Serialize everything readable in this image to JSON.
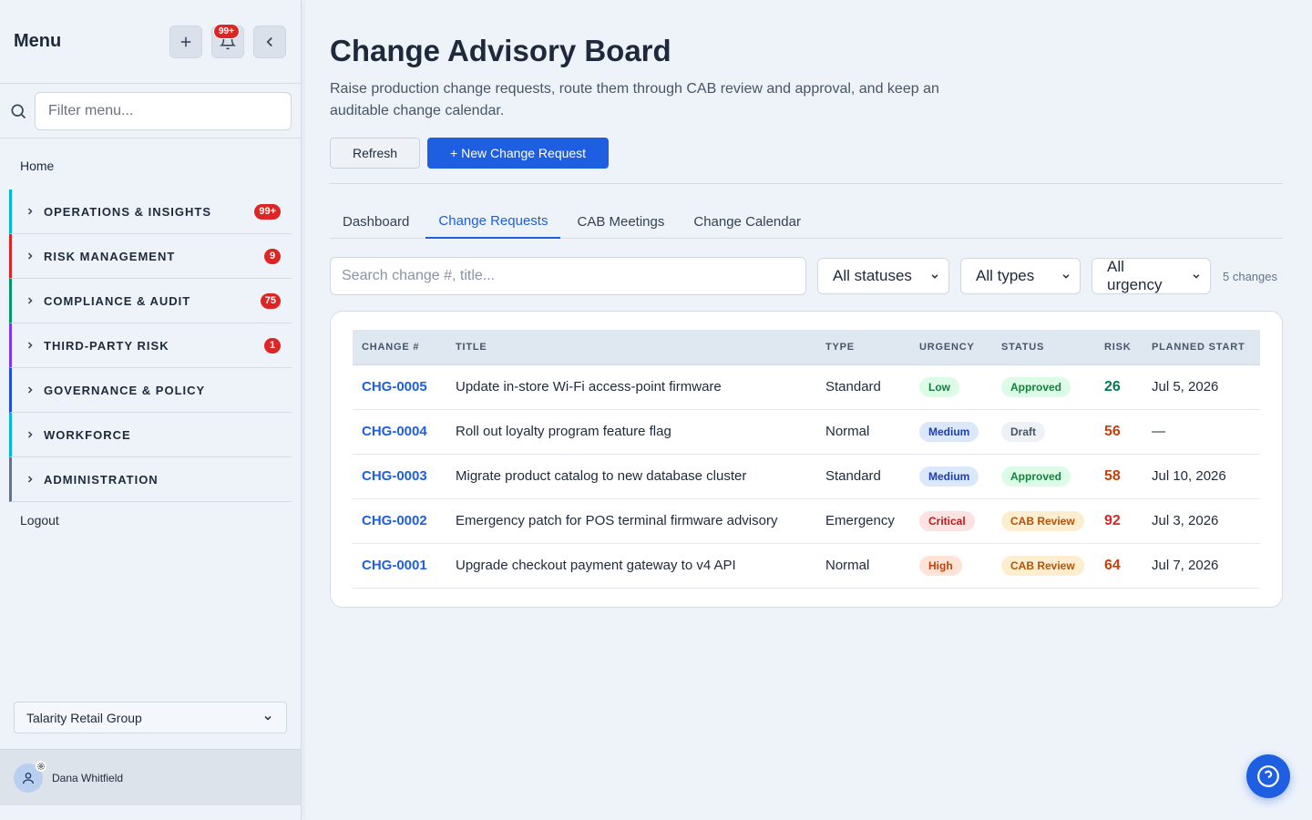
{
  "sidebar": {
    "title": "Menu",
    "notification_count": "99+",
    "filter_placeholder": "Filter menu...",
    "home_label": "Home",
    "logout_label": "Logout",
    "sections": [
      {
        "label": "OPERATIONS & INSIGHTS",
        "badge": "99+",
        "color": "#06b6d4"
      },
      {
        "label": "RISK MANAGEMENT",
        "badge": "9",
        "color": "#dc2626"
      },
      {
        "label": "COMPLIANCE & AUDIT",
        "badge": "75",
        "color": "#059669"
      },
      {
        "label": "THIRD-PARTY RISK",
        "badge": "1",
        "color": "#7c3aed"
      },
      {
        "label": "GOVERNANCE & POLICY",
        "badge": "",
        "color": "#1d4ed8"
      },
      {
        "label": "WORKFORCE",
        "badge": "",
        "color": "#06b6d4"
      },
      {
        "label": "ADMINISTRATION",
        "badge": "",
        "color": "#64748b"
      }
    ],
    "org_name": "Talarity Retail Group",
    "user_name": "Dana Whitfield"
  },
  "page": {
    "title": "Change Advisory Board",
    "description": "Raise production change requests, route them through CAB review and approval, and keep an auditable change calendar.",
    "refresh_label": "Refresh",
    "new_request_label": "+ New Change Request"
  },
  "tabs": [
    {
      "label": "Dashboard",
      "active": false
    },
    {
      "label": "Change Requests",
      "active": true
    },
    {
      "label": "CAB Meetings",
      "active": false
    },
    {
      "label": "Change Calendar",
      "active": false
    }
  ],
  "filters": {
    "search_placeholder": "Search change #, title...",
    "status": "All statuses",
    "type": "All types",
    "urgency": "All urgency",
    "count_text": "5 changes"
  },
  "table": {
    "columns": [
      "CHANGE #",
      "TITLE",
      "TYPE",
      "URGENCY",
      "STATUS",
      "RISK",
      "PLANNED START"
    ],
    "rows": [
      {
        "id": "CHG-0005",
        "title": "Update in-store Wi-Fi access-point firmware",
        "type": "Standard",
        "urgency": "Low",
        "status": "Approved",
        "risk": "26",
        "start": "Jul 5, 2026"
      },
      {
        "id": "CHG-0004",
        "title": "Roll out loyalty program feature flag",
        "type": "Normal",
        "urgency": "Medium",
        "status": "Draft",
        "risk": "56",
        "start": "—"
      },
      {
        "id": "CHG-0003",
        "title": "Migrate product catalog to new database cluster",
        "type": "Standard",
        "urgency": "Medium",
        "status": "Approved",
        "risk": "58",
        "start": "Jul 10, 2026"
      },
      {
        "id": "CHG-0002",
        "title": "Emergency patch for POS terminal firmware advisory",
        "type": "Emergency",
        "urgency": "Critical",
        "status": "CAB Review",
        "risk": "92",
        "start": "Jul 3, 2026"
      },
      {
        "id": "CHG-0001",
        "title": "Upgrade checkout payment gateway to v4 API",
        "type": "Normal",
        "urgency": "High",
        "status": "CAB Review",
        "risk": "64",
        "start": "Jul 7, 2026"
      }
    ]
  },
  "colors": {
    "accent": "#1d5fe0",
    "urgency": {
      "Low": {
        "bg": "#dcfce7",
        "fg": "#15803d"
      },
      "Medium": {
        "bg": "#dbe7fb",
        "fg": "#1e40af"
      },
      "High": {
        "bg": "#fde4d6",
        "fg": "#c2410c"
      },
      "Critical": {
        "bg": "#fde2e2",
        "fg": "#b91c1c"
      }
    },
    "status": {
      "Approved": {
        "bg": "#dcfce7",
        "fg": "#15803d"
      },
      "Draft": {
        "bg": "#eef1f5",
        "fg": "#475569"
      },
      "CAB Review": {
        "bg": "#fdeecf",
        "fg": "#b45309"
      }
    },
    "risk_low": "#047857",
    "risk_med": "#c2410c",
    "risk_high": "#dc2626"
  }
}
